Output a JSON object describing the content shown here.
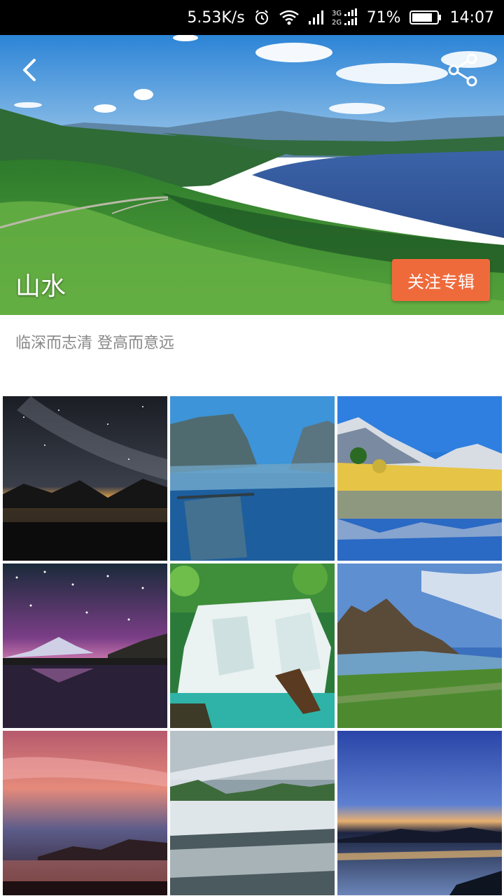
{
  "status_bar": {
    "net_speed": "5.53K/s",
    "signal_labels": "3G 2G",
    "battery": "71%",
    "time": "14:07",
    "icons": [
      "alarm-icon",
      "wifi-icon",
      "signal-icon",
      "dual-sim-signal-icon",
      "battery-icon"
    ]
  },
  "header": {
    "back_icon": "chevron-left-icon",
    "share_icon": "share-icon",
    "title": "山水",
    "follow_label": "关注专辑",
    "follow_color": "#ef6a3b"
  },
  "description": "临深而志清 登高而意远",
  "gallery": {
    "items": [
      {
        "name": "milky-way-night-lake"
      },
      {
        "name": "blue-cliff-river"
      },
      {
        "name": "mountain-lake-reflection"
      },
      {
        "name": "starry-sky-mountain"
      },
      {
        "name": "forest-waterfall"
      },
      {
        "name": "rocky-peaks-coast"
      },
      {
        "name": "pink-sunset-sky"
      },
      {
        "name": "misty-lake-cascade"
      },
      {
        "name": "blue-dusk-lake"
      }
    ]
  }
}
